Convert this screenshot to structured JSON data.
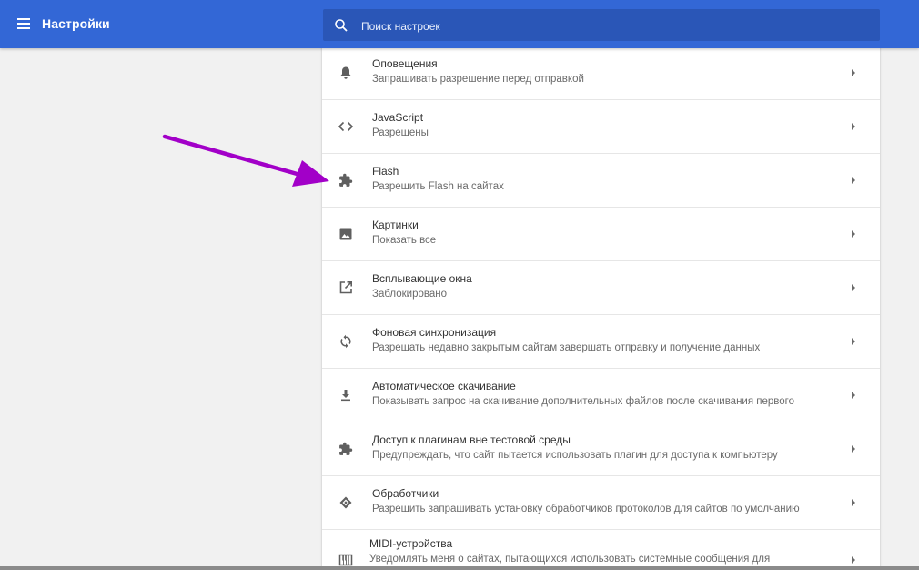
{
  "header": {
    "title": "Настройки",
    "search_placeholder": "Поиск настроек"
  },
  "settings": [
    {
      "icon": "bell-icon",
      "title": "Оповещения",
      "subtitle": "Запрашивать разрешение перед отправкой"
    },
    {
      "icon": "code-icon",
      "title": "JavaScript",
      "subtitle": "Разрешены"
    },
    {
      "icon": "puzzle-icon",
      "title": "Flash",
      "subtitle": "Разрешить Flash на сайтах"
    },
    {
      "icon": "image-icon",
      "title": "Картинки",
      "subtitle": "Показать все"
    },
    {
      "icon": "open-in-new-icon",
      "title": "Всплывающие окна",
      "subtitle": "Заблокировано"
    },
    {
      "icon": "sync-icon",
      "title": "Фоновая синхронизация",
      "subtitle": "Разрешать недавно закрытым сайтам завершать отправку и получение данных"
    },
    {
      "icon": "download-icon",
      "title": "Автоматическое скачивание",
      "subtitle": "Показывать запрос на скачивание дополнительных файлов после скачивания первого"
    },
    {
      "icon": "puzzle-icon",
      "title": "Доступ к плагинам вне тестовой среды",
      "subtitle": "Предупреждать, что сайт пытается использовать плагин для доступа к компьютеру"
    },
    {
      "icon": "handler-icon",
      "title": "Обработчики",
      "subtitle": "Разрешить запрашивать установку обработчиков протоколов для сайтов по умолчанию"
    },
    {
      "icon": "piano-icon",
      "title": "MIDI-устройства",
      "subtitle": "Уведомлять меня о сайтах, пытающихся использовать системные сообщения для"
    }
  ],
  "colors": {
    "header_bg": "#3367d6",
    "search_bg": "#2a56b7",
    "annotation_arrow": "#a200c8"
  }
}
